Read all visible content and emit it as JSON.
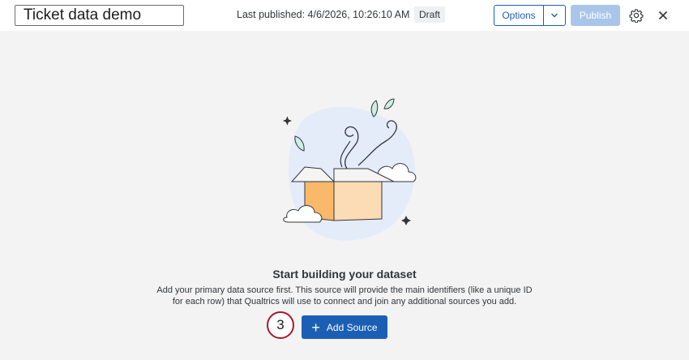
{
  "header": {
    "title_value": "Ticket data demo",
    "last_published": "Last published: 4/6/2026, 10:26:10 AM",
    "status_badge": "Draft",
    "options_label": "Options",
    "publish_label": "Publish",
    "icons": {
      "settings": "gear-icon",
      "close": "close-icon",
      "caret": "chevron-down-icon"
    }
  },
  "empty_state": {
    "heading": "Start building your dataset",
    "description": "Add your primary data source first. This source will provide the main identifiers (like a unique ID for each row) that Qualtrics will use to connect and join any additional sources you add.",
    "step_number": "3",
    "add_source_label": "Add Source",
    "add_source_icon": "plus-icon"
  },
  "colors": {
    "accent": "#1a5fb4",
    "publish_disabled": "#a9c6ea",
    "step_ring": "#a31b2e",
    "background": "#f3f3f3"
  }
}
